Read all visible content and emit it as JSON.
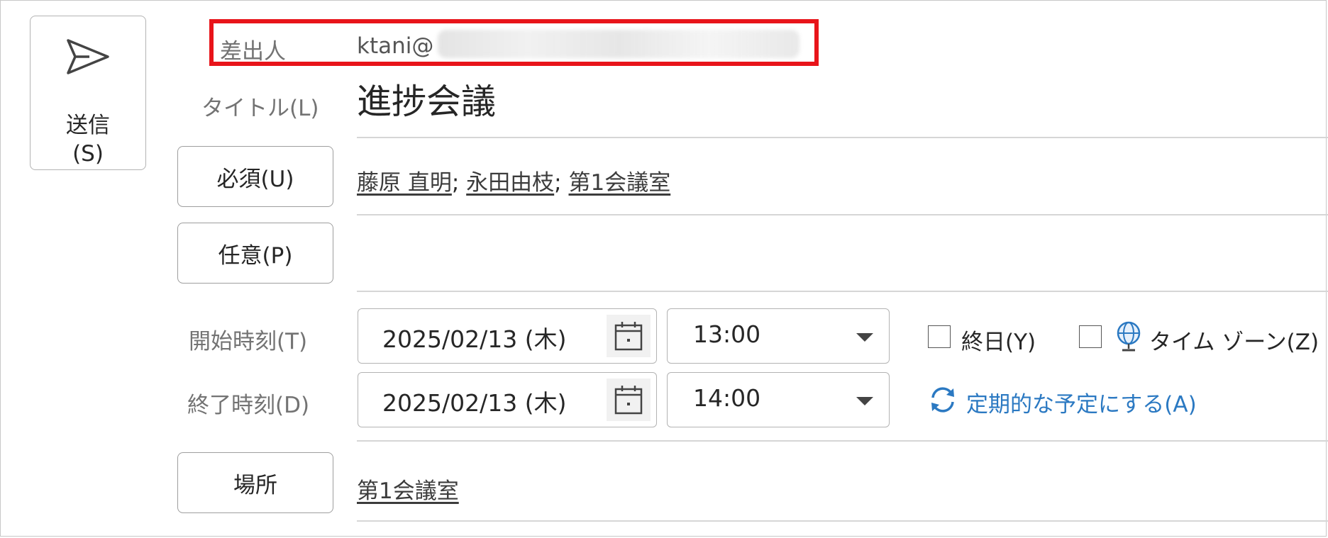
{
  "send": {
    "label_line1": "送信",
    "label_line2": "(S)"
  },
  "from": {
    "label": "差出人",
    "value": "ktani@"
  },
  "title": {
    "label": "タイトル(L)",
    "value": "進捗会議"
  },
  "required": {
    "button_label": "必須(U)",
    "attendees": [
      "藤原 直明",
      "永田由枝",
      "第1会議室"
    ],
    "separator": "; "
  },
  "optional": {
    "button_label": "任意(P)"
  },
  "start": {
    "label": "開始時刻(T)",
    "date": "2025/02/13 (木)",
    "time": "13:00"
  },
  "end": {
    "label": "終了時刻(D)",
    "date": "2025/02/13 (木)",
    "time": "14:00"
  },
  "all_day": {
    "label": "終日(Y)",
    "checked": false
  },
  "time_zone": {
    "label": "タイム ゾーン(Z)",
    "checked": false
  },
  "recurrence": {
    "label": "定期的な予定にする(A)"
  },
  "location": {
    "button_label": "場所",
    "value": "第1会議室"
  },
  "colors": {
    "highlight_box": "#e8141a",
    "link_blue": "#2b79c2"
  }
}
